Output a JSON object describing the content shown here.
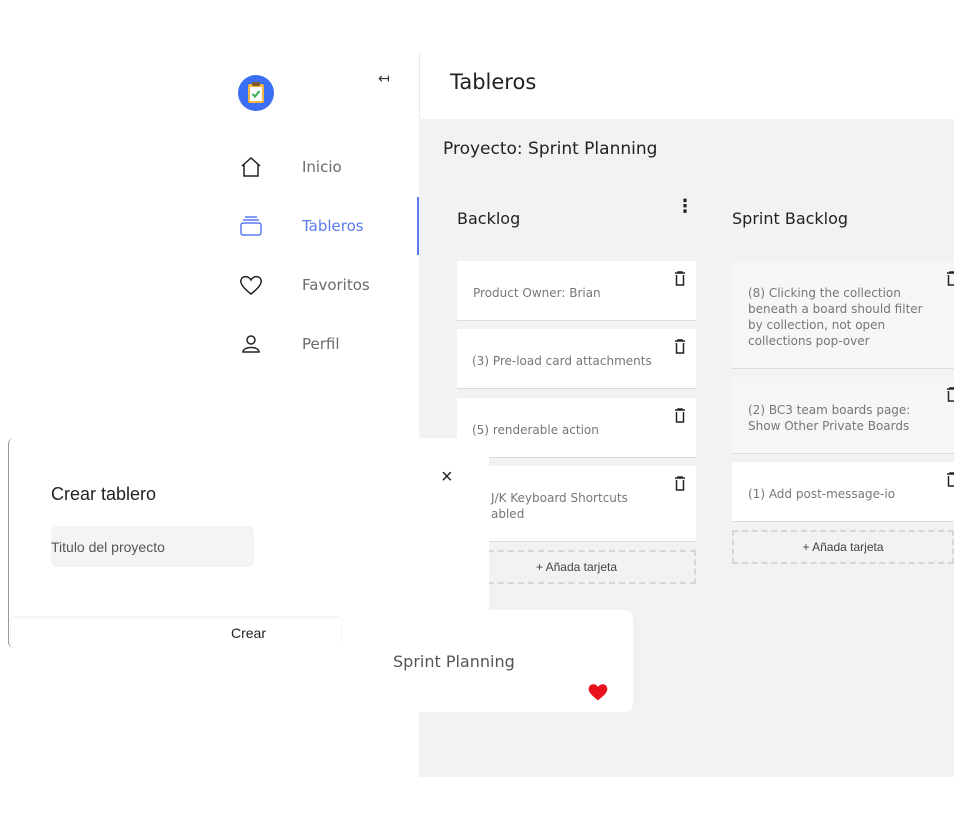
{
  "sidebar": {
    "collapse_icon": "collapse-left-icon",
    "items": [
      {
        "label": "Inicio",
        "icon": "home-icon"
      },
      {
        "label": "Tableros",
        "icon": "boards-icon",
        "active": true
      },
      {
        "label": "Favoritos",
        "icon": "heart-icon"
      },
      {
        "label": "Perfil",
        "icon": "user-icon"
      }
    ]
  },
  "header": {
    "title": "Tableros"
  },
  "project": {
    "title": "Proyecto: Sprint Planning"
  },
  "columns": [
    {
      "title": "Backlog",
      "cards": [
        "Product Owner: Brian",
        "(3) Pre-load card attachments",
        "(5) renderable action",
        "J/K Keyboard Shortcuts",
        "abled"
      ],
      "add_label": "+ Añada tarjeta"
    },
    {
      "title": "Sprint Backlog",
      "cards": [
        "(8) Clicking the collection",
        "beneath a board should filter",
        "by collection, not open",
        "collections pop-over",
        "(2) BC3 team boards page:",
        "Show Other Private Boards",
        "(1) Add post-message-io"
      ],
      "add_label": "+ Añada tarjeta"
    }
  ],
  "favorite": {
    "name": "Sprint Planning"
  },
  "modal": {
    "title": "Crear tablero",
    "input_placeholder": "Titulo del proyecto",
    "create_label": "Crear",
    "close": "×"
  },
  "colors": {
    "accent": "#5b7cf0",
    "logo": "#3b6ff3",
    "heart": "#e8121f",
    "board_bg": "#f1f2f4"
  }
}
